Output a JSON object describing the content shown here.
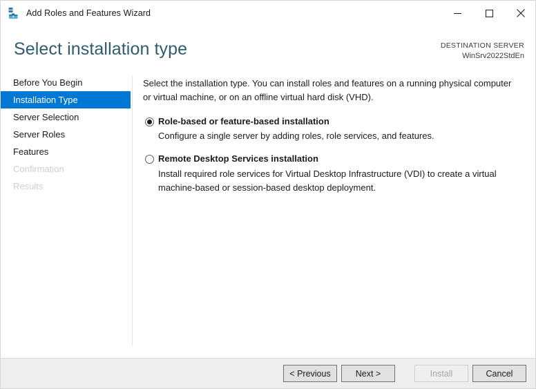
{
  "window": {
    "title": "Add Roles and Features Wizard",
    "icon": "server-wizard-icon",
    "controls": {
      "minimize": "minimize-icon",
      "maximize": "maximize-icon",
      "close": "close-icon"
    }
  },
  "header": {
    "page_title": "Select installation type",
    "destination_label": "DESTINATION SERVER",
    "destination_value": "WinSrv2022StdEn"
  },
  "sidebar": {
    "items": [
      {
        "label": "Before You Begin",
        "state": "enabled"
      },
      {
        "label": "Installation Type",
        "state": "selected"
      },
      {
        "label": "Server Selection",
        "state": "enabled"
      },
      {
        "label": "Server Roles",
        "state": "enabled"
      },
      {
        "label": "Features",
        "state": "enabled"
      },
      {
        "label": "Confirmation",
        "state": "disabled"
      },
      {
        "label": "Results",
        "state": "disabled"
      }
    ]
  },
  "main": {
    "intro": "Select the installation type. You can install roles and features on a running physical computer or virtual machine, or on an offline virtual hard disk (VHD).",
    "options": [
      {
        "title": "Role-based or feature-based installation",
        "description": "Configure a single server by adding roles, role services, and features.",
        "selected": true
      },
      {
        "title": "Remote Desktop Services installation",
        "description": "Install required role services for Virtual Desktop Infrastructure (VDI) to create a virtual machine-based or session-based desktop deployment.",
        "selected": false
      }
    ]
  },
  "footer": {
    "previous_label": "< Previous",
    "next_label": "Next >",
    "install_label": "Install",
    "cancel_label": "Cancel",
    "install_enabled": false
  },
  "colors": {
    "accent": "#0078d4",
    "title_teal": "#2f5c6e",
    "footer_bg": "#eeeeee",
    "disabled_text": "#cfcfcf"
  }
}
